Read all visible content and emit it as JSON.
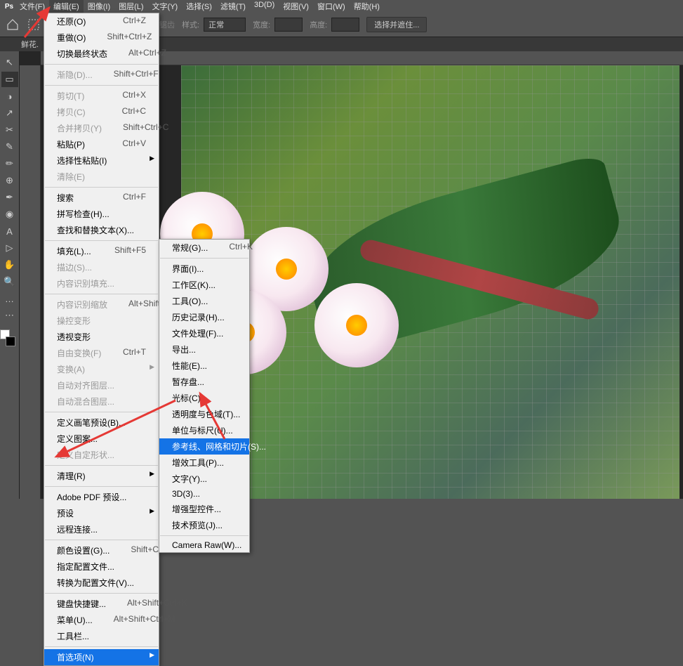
{
  "menubar": {
    "items": [
      "文件(F)",
      "编辑(E)",
      "图像(I)",
      "图层(L)",
      "文字(Y)",
      "选择(S)",
      "滤镜(T)",
      "3D(D)",
      "视图(V)",
      "窗口(W)",
      "帮助(H)"
    ],
    "active_index": 1
  },
  "optbar": {
    "mode_label": "样式:",
    "mode_value": "正常",
    "width_label": "宽度:",
    "height_label": "高度:",
    "button_label": "选择并遮住..."
  },
  "docbar": {
    "tab": "鲜花."
  },
  "tools": [
    "↖",
    "▭",
    "◑",
    "↗",
    "✂",
    "✎",
    "✏",
    "⊕",
    "✒",
    "◉",
    "A",
    "▷",
    "✋",
    "🔍",
    "…",
    "⋯"
  ],
  "edit_menu": [
    {
      "label": "还原(O)",
      "shortcut": "Ctrl+Z"
    },
    {
      "label": "重做(O)",
      "shortcut": "Shift+Ctrl+Z"
    },
    {
      "label": "切换最终状态",
      "shortcut": "Alt+Ctrl+Z"
    },
    {
      "sep": true
    },
    {
      "label": "渐隐(D)...",
      "shortcut": "Shift+Ctrl+F",
      "disabled": true
    },
    {
      "sep": true
    },
    {
      "label": "剪切(T)",
      "shortcut": "Ctrl+X",
      "disabled": true
    },
    {
      "label": "拷贝(C)",
      "shortcut": "Ctrl+C",
      "disabled": true
    },
    {
      "label": "合并拷贝(Y)",
      "shortcut": "Shift+Ctrl+C",
      "disabled": true
    },
    {
      "label": "粘贴(P)",
      "shortcut": "Ctrl+V"
    },
    {
      "label": "选择性粘贴(I)",
      "sub": true
    },
    {
      "label": "清除(E)",
      "disabled": true
    },
    {
      "sep": true
    },
    {
      "label": "搜索",
      "shortcut": "Ctrl+F"
    },
    {
      "label": "拼写检查(H)..."
    },
    {
      "label": "查找和替换文本(X)..."
    },
    {
      "sep": true
    },
    {
      "label": "填充(L)...",
      "shortcut": "Shift+F5"
    },
    {
      "label": "描边(S)...",
      "disabled": true
    },
    {
      "label": "内容识别填充...",
      "disabled": true
    },
    {
      "sep": true
    },
    {
      "label": "内容识别缩放",
      "shortcut": "Alt+Shift+Ctrl+C",
      "disabled": true
    },
    {
      "label": "操控变形",
      "disabled": true
    },
    {
      "label": "透视变形"
    },
    {
      "label": "自由变换(F)",
      "shortcut": "Ctrl+T",
      "disabled": true
    },
    {
      "label": "变换(A)",
      "sub": true,
      "disabled": true
    },
    {
      "label": "自动对齐图层...",
      "disabled": true
    },
    {
      "label": "自动混合图层...",
      "disabled": true
    },
    {
      "sep": true
    },
    {
      "label": "定义画笔预设(B)..."
    },
    {
      "label": "定义图案..."
    },
    {
      "label": "定义自定形状...",
      "disabled": true
    },
    {
      "sep": true
    },
    {
      "label": "清理(R)",
      "sub": true
    },
    {
      "sep": true
    },
    {
      "label": "Adobe PDF 预设..."
    },
    {
      "label": "预设",
      "sub": true
    },
    {
      "label": "远程连接..."
    },
    {
      "sep": true
    },
    {
      "label": "颜色设置(G)...",
      "shortcut": "Shift+Ctrl+K"
    },
    {
      "label": "指定配置文件..."
    },
    {
      "label": "转换为配置文件(V)..."
    },
    {
      "sep": true
    },
    {
      "label": "键盘快捷键...",
      "shortcut": "Alt+Shift+Ctrl+K"
    },
    {
      "label": "菜单(U)...",
      "shortcut": "Alt+Shift+Ctrl+M"
    },
    {
      "label": "工具栏..."
    },
    {
      "sep": true
    },
    {
      "label": "首选项(N)",
      "sub": true,
      "highlighted": true
    }
  ],
  "prefs_submenu": [
    {
      "label": "常规(G)...",
      "shortcut": "Ctrl+K"
    },
    {
      "sep": true
    },
    {
      "label": "界面(I)..."
    },
    {
      "label": "工作区(K)..."
    },
    {
      "label": "工具(O)..."
    },
    {
      "label": "历史记录(H)..."
    },
    {
      "label": "文件处理(F)..."
    },
    {
      "label": "导出..."
    },
    {
      "label": "性能(E)..."
    },
    {
      "label": "暂存盘..."
    },
    {
      "label": "光标(C)..."
    },
    {
      "label": "透明度与色域(T)..."
    },
    {
      "label": "单位与标尺(U)..."
    },
    {
      "label": "参考线、网格和切片(S)...",
      "highlighted": true
    },
    {
      "label": "增效工具(P)..."
    },
    {
      "label": "文字(Y)..."
    },
    {
      "label": "3D(3)..."
    },
    {
      "label": "增强型控件..."
    },
    {
      "label": "技术预览(J)..."
    },
    {
      "sep": true
    },
    {
      "label": "Camera Raw(W)..."
    }
  ]
}
